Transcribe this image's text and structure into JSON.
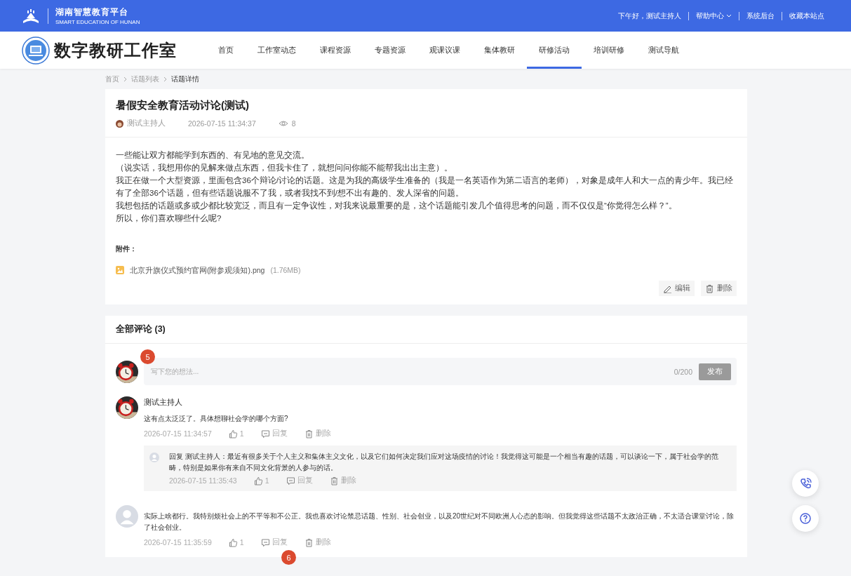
{
  "header": {
    "platform_name": "湖南智慧教育平台",
    "platform_subtitle": "SMART EDUCATION OF HUNAN",
    "greeting": "下午好，测试主持人",
    "links": [
      {
        "label": "帮助中心",
        "has_menu": true
      },
      {
        "label": "系统后台",
        "has_menu": false
      },
      {
        "label": "收藏本站点",
        "has_menu": false
      }
    ]
  },
  "site": {
    "title": "数字教研工作室",
    "nav": [
      {
        "label": "首页",
        "selected": false
      },
      {
        "label": "工作室动态",
        "selected": false
      },
      {
        "label": "课程资源",
        "selected": false
      },
      {
        "label": "专题资源",
        "selected": false
      },
      {
        "label": "观课议课",
        "selected": false
      },
      {
        "label": "集体教研",
        "selected": false
      },
      {
        "label": "研修活动",
        "selected": true
      },
      {
        "label": "培训研修",
        "selected": false
      },
      {
        "label": "测试导航",
        "selected": false
      }
    ]
  },
  "breadcrumb": [
    "首页",
    "话题列表",
    "话题详情"
  ],
  "topic": {
    "title": "暑假安全教育活动讨论(测试)",
    "author": "测试主持人",
    "time": "2026-07-15 11:34:37",
    "views": "8",
    "paragraphs": [
      "一些能让双方都能学到东西的、有见地的意见交流。",
      "（说实话，我想用你的见解来做点东西，但我卡住了，就想问问你能不能帮我出出主意）。",
      "我正在做一个大型资源，里面包含36个辩论/讨论的话题。这是为我的高级学生准备的（我是一名英语作为第二语言的老师），对象是成年人和大一点的青少年。我已经有了全部36个话题，但有些话题说服不了我，或者我找不到/想不出有趣的、发人深省的问题。",
      "我想包括的话题或多或少都比较宽泛，而且有一定争议性，对我来说最重要的是，这个话题能引发几个值得思考的问题，而不仅仅是“你觉得怎么样？”。",
      "所以，你们喜欢聊些什么呢?"
    ],
    "attachments_label": "附件：",
    "attachments": [
      {
        "name": "北京升旗仪式预约官网(附参观须知).png",
        "size": "(1.76MB)"
      }
    ],
    "actions": [
      {
        "kind": "edit",
        "label": "编辑"
      },
      {
        "kind": "delete",
        "label": "删除"
      }
    ]
  },
  "comments": {
    "title": "全部评论 (3)",
    "input": {
      "placeholder": "写下您的想法...",
      "counter": "0/200",
      "button": "发布",
      "marker": "5"
    },
    "items": [
      {
        "kind": "picture",
        "author": "测试主持人",
        "text": "这有点太泛泛了。具体想聊社会学的哪个方面?",
        "time": "2026-07-15 11:34:57",
        "likes": "1",
        "reply": "回复",
        "delete": "删除",
        "replies": [
          {
            "text": "回复 测试主持人：最近有很多关于个人主义和集体主义文化，以及它们如何决定我们应对这场疫情的讨论！我觉得这可能是一个相当有趣的话题，可以谈论一下，属于社会学的范畴，特别是如果你有来自不同文化背景的人参与的话。",
            "time": "2026-07-15 11:35:43",
            "likes": "1",
            "reply": "回复",
            "delete": "删除"
          }
        ]
      },
      {
        "kind": "default",
        "text": "实际上啥都行。我特别烦社会上的不平等和不公正。我也喜欢讨论禁忌话题、性别、社会创业，以及20世纪对不同欧洲人心态的影响。但我觉得这些话题不太政治正确，不太适合课堂讨论，除了社会创业。",
        "time": "2026-07-15 11:35:59",
        "likes": "1",
        "reply": "回复",
        "delete": "删除",
        "marker": "6"
      }
    ]
  }
}
